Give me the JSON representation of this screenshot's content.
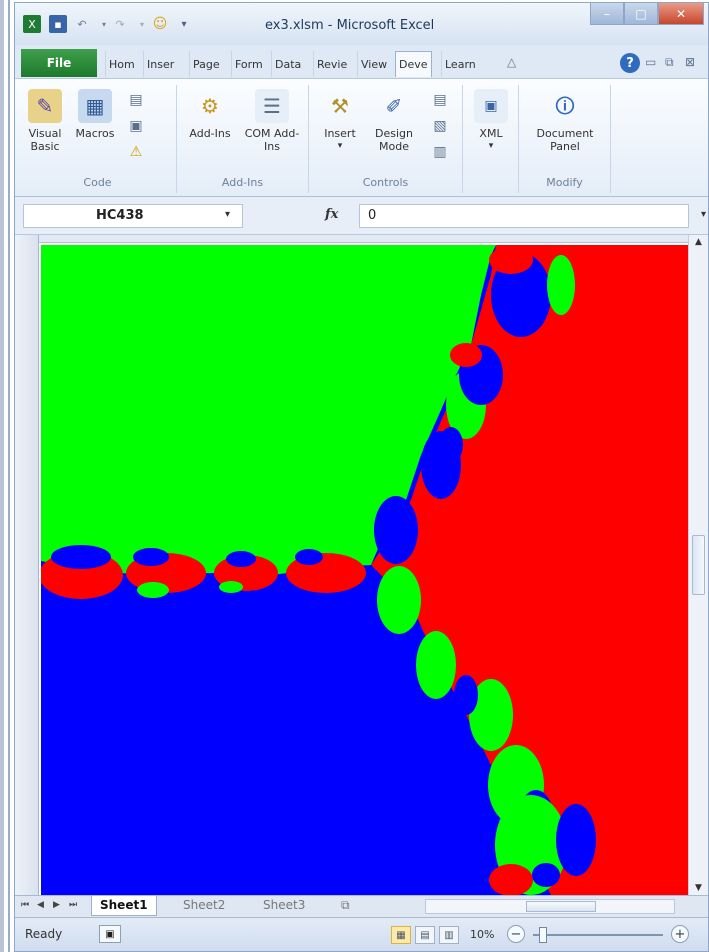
{
  "window": {
    "title": "ex3.xlsm - Microsoft Excel"
  },
  "tabs": {
    "file": "File",
    "items": [
      "Hom",
      "Inser",
      "Page",
      "Form",
      "Data",
      "Revie",
      "View",
      "Deve",
      "Learn"
    ],
    "active": "Deve"
  },
  "ribbon": {
    "groups": {
      "code": {
        "label": "Code",
        "visual_basic": "Visual Basic",
        "macros": "Macros"
      },
      "addins": {
        "label": "Add-Ins",
        "addins": "Add-Ins",
        "com_addins": "COM Add-Ins"
      },
      "controls": {
        "label": "Controls",
        "insert": "Insert",
        "design_mode": "Design Mode"
      },
      "xml": {
        "label": "XML"
      },
      "modify": {
        "label": "Modify",
        "document_panel": "Document Panel"
      }
    }
  },
  "formula_bar": {
    "name_box": "HC438",
    "fx": "fx",
    "value": "0"
  },
  "fractal": {
    "colors": {
      "green": "#00ff00",
      "red": "#ff0000",
      "blue": "#0000ff"
    }
  },
  "sheet_tabs": {
    "items": [
      "Sheet1",
      "Sheet2",
      "Sheet3"
    ],
    "active": "Sheet1"
  },
  "status": {
    "ready": "Ready",
    "zoom": "10%"
  }
}
